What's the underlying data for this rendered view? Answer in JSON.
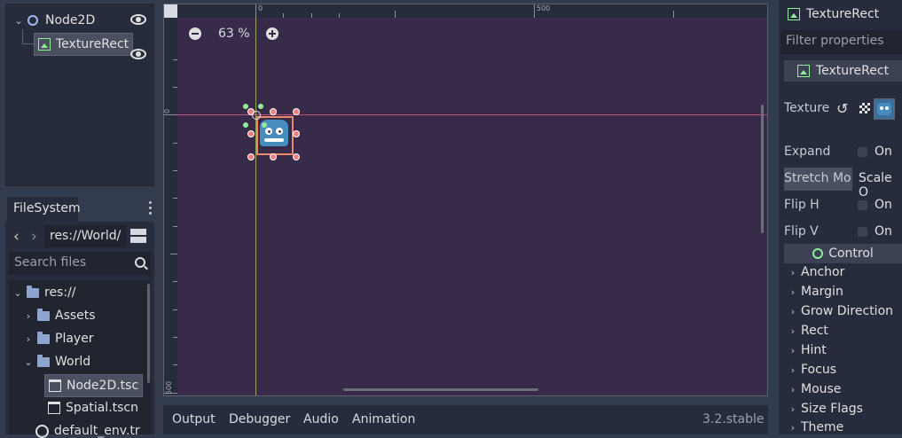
{
  "scene_tree": {
    "items": [
      {
        "label": "Node2D"
      },
      {
        "label": "TextureRect"
      }
    ]
  },
  "filesystem": {
    "tab_label": "FileSystem",
    "path": "res://World/",
    "search_placeholder": "Search files",
    "items": [
      {
        "label": "res://"
      },
      {
        "label": "Assets"
      },
      {
        "label": "Player"
      },
      {
        "label": "World"
      },
      {
        "label": "Node2D.tsc"
      },
      {
        "label": "Spatial.tscn"
      },
      {
        "label": "default_env.tr"
      }
    ]
  },
  "viewport": {
    "zoom": "63 %",
    "ruler_top": [
      "0",
      "500"
    ],
    "ruler_left": [
      "0",
      "500"
    ]
  },
  "bottom_panel": {
    "tabs": [
      "Output",
      "Debugger",
      "Audio",
      "Animation"
    ],
    "version": "3.2.stable"
  },
  "inspector": {
    "node_title": "TextureRect",
    "filter_placeholder": "Filter properties",
    "class_header": "TextureRect",
    "texture_label": "Texture",
    "props": [
      {
        "label": "Expand",
        "value": "On"
      },
      {
        "label": "Stretch Mo",
        "value": "Scale O"
      },
      {
        "label": "Flip H",
        "value": "On"
      },
      {
        "label": "Flip V",
        "value": "On"
      }
    ],
    "control_header": "Control",
    "sections": [
      "Anchor",
      "Margin",
      "Grow Direction",
      "Rect",
      "Hint",
      "Focus",
      "Mouse",
      "Size Flags",
      "Theme"
    ]
  },
  "colors": {
    "background": "#333b4f",
    "panel": "#262c3b",
    "viewport": "#372b49",
    "accent": "#8eef97"
  }
}
